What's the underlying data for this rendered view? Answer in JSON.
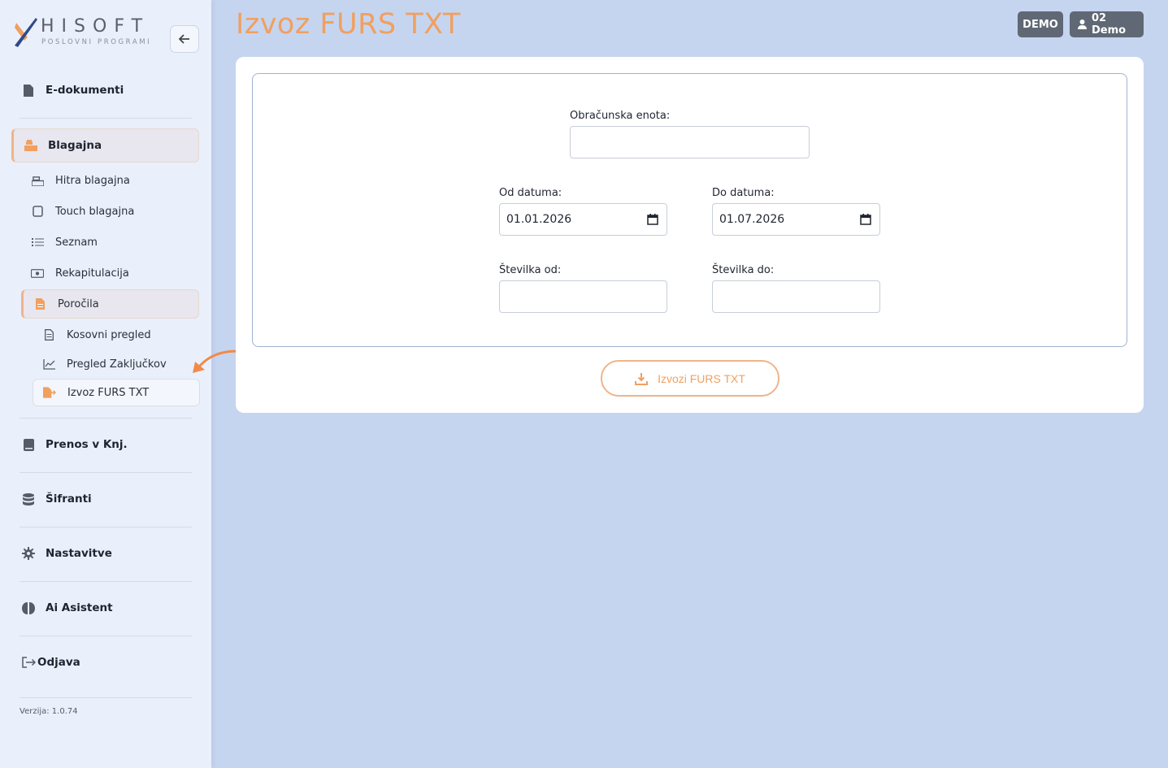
{
  "brand": {
    "name": "HISOFT",
    "tagline": "POSLOVNI PROGRAMI"
  },
  "header": {
    "title": "Izvoz FURS TXT",
    "env_badge": "DEMO",
    "user_badge": "02 Demo"
  },
  "sidebar": {
    "items": [
      {
        "label": "E-dokumenti",
        "icon": "file-icon"
      },
      {
        "label": "Blagajna",
        "icon": "cash-register-icon",
        "active": true,
        "children": [
          {
            "label": "Hitra blagajna",
            "icon": "cash-register-icon"
          },
          {
            "label": "Touch blagajna",
            "icon": "tablet-icon"
          },
          {
            "label": "Seznam",
            "icon": "list-icon"
          },
          {
            "label": "Rekapitulacija",
            "icon": "money-bill-icon"
          },
          {
            "label": "Poročila",
            "icon": "report-file-icon",
            "active": true,
            "children": [
              {
                "label": "Kosovni pregled",
                "icon": "document-list-icon"
              },
              {
                "label": "Pregled Zaključkov",
                "icon": "line-chart-icon"
              },
              {
                "label": "Izvoz FURS TXT",
                "icon": "file-export-icon",
                "active": true
              }
            ]
          }
        ]
      },
      {
        "label": "Prenos v Knj.",
        "icon": "book-icon"
      },
      {
        "label": "Šifranti",
        "icon": "database-icon"
      },
      {
        "label": "Nastavitve",
        "icon": "gear-icon"
      },
      {
        "label": "Ai Asistent",
        "icon": "brain-icon"
      },
      {
        "label": "Odjava",
        "icon": "logout-icon"
      }
    ],
    "version": "Verzija: 1.0.74"
  },
  "form": {
    "unit_label": "Obračunska enota:",
    "unit_value": "",
    "from_date_label": "Od datuma:",
    "from_date_value": "01.01.2026",
    "to_date_label": "Do datuma:",
    "to_date_value": "01.07.2026",
    "from_number_label": "Številka od:",
    "from_number_value": "",
    "to_number_label": "Številka do:",
    "to_number_value": "",
    "export_button": "Izvozi FURS TXT"
  },
  "colors": {
    "accent": "#f0a060",
    "background": "#c5d5f0",
    "badge": "#5f6874"
  }
}
